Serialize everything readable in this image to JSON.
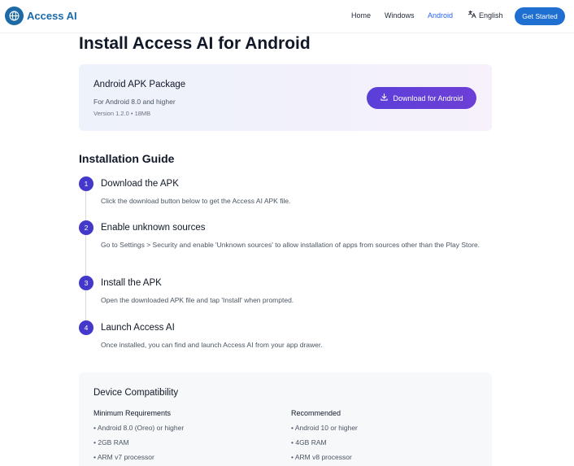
{
  "header": {
    "logo_text": "Access AI",
    "nav": [
      "Home",
      "Windows",
      "Android"
    ],
    "active_nav": "Android",
    "language": "English",
    "cta": "Get Started"
  },
  "page": {
    "title": "Install Access AI for Android"
  },
  "package": {
    "title": "Android APK Package",
    "requirement": "For Android 8.0 and higher",
    "version_info": "Version 1.2.0 • 18MB",
    "download_label": "Download for Android"
  },
  "guide": {
    "title": "Installation Guide",
    "steps": [
      {
        "num": "1",
        "title": "Download the APK",
        "desc": "Click the download button below to get the Access AI APK file."
      },
      {
        "num": "2",
        "title": "Enable unknown sources",
        "desc": "Go to Settings > Security and enable 'Unknown sources' to allow installation of apps from sources other than the Play Store."
      },
      {
        "num": "3",
        "title": "Install the APK",
        "desc": "Open the downloaded APK file and tap 'Install' when prompted."
      },
      {
        "num": "4",
        "title": "Launch Access AI",
        "desc": "Once installed, you can find and launch Access AI from your app drawer."
      }
    ]
  },
  "compatibility": {
    "title": "Device Compatibility",
    "minimum": {
      "heading": "Minimum Requirements",
      "items": [
        "• Android 8.0 (Oreo) or higher",
        "• 2GB RAM",
        "• ARM v7 processor"
      ]
    },
    "recommended": {
      "heading": "Recommended",
      "items": [
        "• Android 10 or higher",
        "• 4GB RAM",
        "• ARM v8 processor"
      ]
    }
  },
  "colors": {
    "accent": "#4338ca",
    "brand": "#1a6aa8",
    "cta": "#1f6fd1"
  },
  "icons": {
    "logo": "globe-icon",
    "language": "translate-icon",
    "download": "download-icon"
  }
}
